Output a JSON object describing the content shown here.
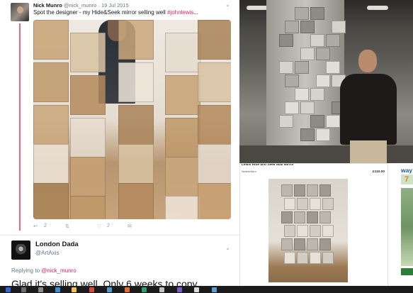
{
  "tweet1": {
    "author_name": "Nick Munro",
    "author_handle": "@nick_munro",
    "date": "· 19 Jul 2015",
    "text_main": "Spot the designer - my Hide&Seek mirror selling well ",
    "text_hashtag": "#johnlewis",
    "text_ellipsis": "...",
    "chevron_icon": "chevron-down-icon",
    "reply_count": "2",
    "retweet_icon": "retweet-icon",
    "like_count": "2",
    "colors": {
      "hashtag": "#e0245e",
      "thread_line": "#e1354d"
    }
  },
  "tweet2": {
    "author_name": "London Dada",
    "author_handle": "@ArtAxis",
    "replying_prefix": "Replying to ",
    "replying_to": "@nick_munro",
    "text": "Glad it's selling well. Only 6 weeks to copy"
  },
  "listing": {
    "title": "Lewis Hide and Seek Wall Mirror",
    "seller": "Neal/whilzro",
    "price": "£110.00",
    "footer": "143 days ago"
  },
  "ad": {
    "brand": "way",
    "number": "7"
  }
}
